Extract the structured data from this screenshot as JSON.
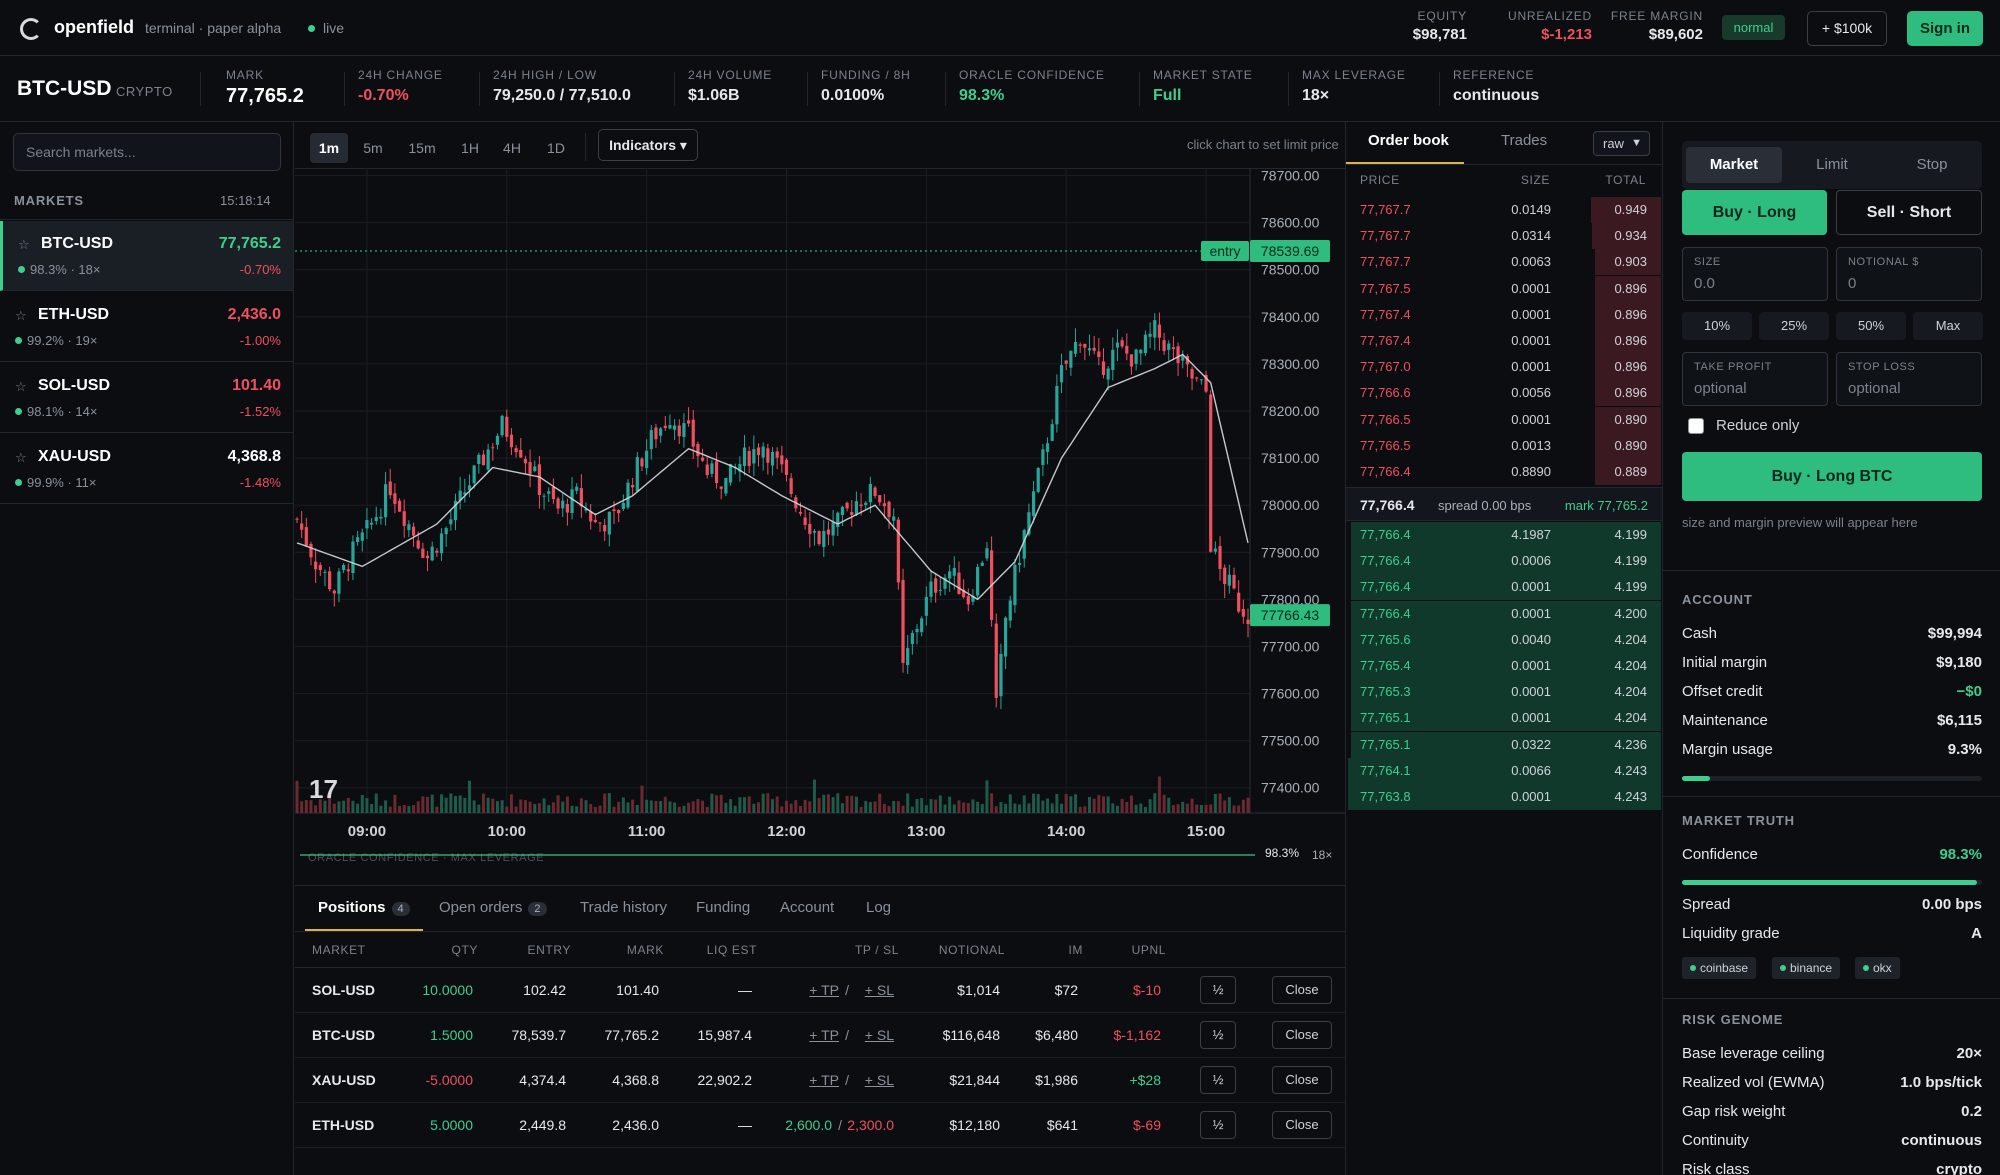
{
  "app": {
    "brand": "openfield",
    "tagline": "terminal · paper alpha",
    "status": "live"
  },
  "account_top": {
    "equity_label": "EQUITY",
    "equity": "$98,781",
    "unrealized_label": "UNREALIZED",
    "unrealized": "$-1,213",
    "free_margin_label": "FREE MARGIN",
    "free_margin": "$89,602",
    "mode": "normal",
    "add_funds": "+ $100k",
    "sign_in": "Sign in"
  },
  "ticker": {
    "symbol": "BTC-USD",
    "class": "CRYPTO",
    "stats": [
      {
        "label": "MARK",
        "value": "77,765.2"
      },
      {
        "label": "24H CHANGE",
        "value": "-0.70%"
      },
      {
        "label": "24H HIGH / LOW",
        "value": "79,250.0 / 77,510.0"
      },
      {
        "label": "24H VOLUME",
        "value": "$1.06B"
      },
      {
        "label": "FUNDING / 8H",
        "value": "0.0100%"
      },
      {
        "label": "ORACLE CONFIDENCE",
        "value": "98.3%"
      },
      {
        "label": "MARKET STATE",
        "value": "Full"
      },
      {
        "label": "MAX LEVERAGE",
        "value": "18×"
      },
      {
        "label": "REFERENCE",
        "value": "continuous"
      }
    ]
  },
  "markets": {
    "search_placeholder": "Search markets...",
    "title": "MARKETS",
    "time": "15:18:14",
    "items": [
      {
        "symbol": "BTC-USD",
        "price": "77,765.2",
        "sub": "98.3% · 18×",
        "change": "-0.70%"
      },
      {
        "symbol": "ETH-USD",
        "price": "2,436.0",
        "sub": "99.2% · 19×",
        "change": "-1.00%"
      },
      {
        "symbol": "SOL-USD",
        "price": "101.40",
        "sub": "98.1% · 14×",
        "change": "-1.52%"
      },
      {
        "symbol": "XAU-USD",
        "price": "4,368.8",
        "sub": "99.9% · 11×",
        "change": "-1.48%"
      }
    ]
  },
  "chart": {
    "timeframes": [
      "1m",
      "5m",
      "15m",
      "1H",
      "4H",
      "1D"
    ],
    "selected_timeframe": "1m",
    "indicators_label": "Indicators ▾",
    "hint": "click chart to set limit price",
    "footer_label": "ORACLE CONFIDENCE · MAX LEVERAGE",
    "footer_conf": "98.3%",
    "footer_lev": "18×"
  },
  "chart_data": {
    "type": "candlestick",
    "x_ticks": [
      "09:00",
      "10:00",
      "11:00",
      "12:00",
      "13:00",
      "14:00",
      "15:00"
    ],
    "y_ticks": [
      "78700.00",
      "78600.00",
      "78500.00",
      "78400.00",
      "78300.00",
      "78200.00",
      "78100.00",
      "78000.00",
      "77900.00",
      "77800.00",
      "77700.00",
      "77600.00",
      "77500.00",
      "77400.00"
    ],
    "ylim": [
      77357,
      78716
    ],
    "entry_label": "entry",
    "entry_price": "78539.69",
    "last_price": "77766.43",
    "close_path": [
      [
        0,
        77970
      ],
      [
        4,
        77880
      ],
      [
        8,
        77820
      ],
      [
        12,
        77900
      ],
      [
        16,
        77960
      ],
      [
        20,
        78040
      ],
      [
        24,
        77960
      ],
      [
        28,
        77890
      ],
      [
        32,
        77950
      ],
      [
        36,
        78030
      ],
      [
        40,
        78100
      ],
      [
        44,
        78170
      ],
      [
        48,
        78120
      ],
      [
        52,
        78040
      ],
      [
        56,
        77990
      ],
      [
        60,
        78020
      ],
      [
        64,
        77960
      ],
      [
        68,
        77970
      ],
      [
        72,
        78060
      ],
      [
        76,
        78140
      ],
      [
        80,
        78190
      ],
      [
        84,
        78150
      ],
      [
        88,
        78070
      ],
      [
        92,
        78050
      ],
      [
        96,
        78100
      ],
      [
        100,
        78130
      ],
      [
        104,
        78070
      ],
      [
        108,
        77990
      ],
      [
        112,
        77930
      ],
      [
        116,
        77960
      ],
      [
        120,
        78010
      ],
      [
        124,
        78030
      ],
      [
        128,
        77980
      ],
      [
        130,
        77650
      ],
      [
        132,
        77720
      ],
      [
        136,
        77820
      ],
      [
        140,
        77860
      ],
      [
        144,
        77800
      ],
      [
        148,
        77920
      ],
      [
        150,
        77570
      ],
      [
        152,
        77760
      ],
      [
        156,
        77940
      ],
      [
        160,
        78100
      ],
      [
        164,
        78280
      ],
      [
        168,
        78360
      ],
      [
        172,
        78290
      ],
      [
        176,
        78330
      ],
      [
        180,
        78310
      ],
      [
        184,
        78370
      ],
      [
        188,
        78320
      ],
      [
        192,
        78270
      ],
      [
        195,
        78240
      ],
      [
        196,
        77920
      ],
      [
        198,
        77860
      ],
      [
        200,
        77830
      ],
      [
        202,
        77790
      ],
      [
        204,
        77766
      ]
    ],
    "ma_path": [
      [
        0,
        77920
      ],
      [
        14,
        77870
      ],
      [
        30,
        77960
      ],
      [
        42,
        78080
      ],
      [
        52,
        78060
      ],
      [
        64,
        77980
      ],
      [
        72,
        78020
      ],
      [
        84,
        78120
      ],
      [
        94,
        78080
      ],
      [
        104,
        78020
      ],
      [
        116,
        77960
      ],
      [
        124,
        78000
      ],
      [
        136,
        77860
      ],
      [
        146,
        77800
      ],
      [
        154,
        77880
      ],
      [
        164,
        78100
      ],
      [
        174,
        78250
      ],
      [
        184,
        78290
      ],
      [
        190,
        78320
      ],
      [
        196,
        78260
      ],
      [
        204,
        77920
      ]
    ],
    "volume_profile": [
      1,
      2,
      1,
      3,
      2,
      1,
      4,
      2,
      1,
      2,
      3,
      1,
      2,
      5,
      2,
      1,
      3,
      2,
      1,
      2,
      6,
      3,
      2,
      1,
      8,
      3,
      2,
      1,
      3,
      2,
      4,
      2
    ]
  },
  "positions": {
    "tabs": [
      {
        "label": "Positions",
        "count": "4"
      },
      {
        "label": "Open orders",
        "count": "2"
      },
      {
        "label": "Trade history",
        "count": ""
      },
      {
        "label": "Funding",
        "count": ""
      },
      {
        "label": "Account",
        "count": ""
      },
      {
        "label": "Log",
        "count": ""
      }
    ],
    "columns": [
      "MARKET",
      "QTY",
      "ENTRY",
      "MARK",
      "LIQ EST",
      "TP / SL",
      "NOTIONAL",
      "IM",
      "UPNL"
    ],
    "rows": [
      {
        "market": "SOL-USD",
        "qty": "10.0000",
        "entry": "102.42",
        "mark": "101.40",
        "liq": "—",
        "tp": "+ TP",
        "sl": "+ SL",
        "notional": "$1,014",
        "im": "$72",
        "upnl": "$-10",
        "half": "½",
        "close": "Close"
      },
      {
        "market": "BTC-USD",
        "qty": "1.5000",
        "entry": "78,539.7",
        "mark": "77,765.2",
        "liq": "15,987.4",
        "tp": "+ TP",
        "sl": "+ SL",
        "notional": "$116,648",
        "im": "$6,480",
        "upnl": "$-1,162",
        "half": "½",
        "close": "Close"
      },
      {
        "market": "XAU-USD",
        "qty": "-5.0000",
        "entry": "4,374.4",
        "mark": "4,368.8",
        "liq": "22,902.2",
        "tp": "+ TP",
        "sl": "+ SL",
        "notional": "$21,844",
        "im": "$1,986",
        "upnl": "+$28",
        "half": "½",
        "close": "Close"
      },
      {
        "market": "ETH-USD",
        "qty": "5.0000",
        "entry": "2,449.8",
        "mark": "2,436.0",
        "liq": "—",
        "tp": "2,600.0",
        "sl": "2,300.0",
        "notional": "$12,180",
        "im": "$641",
        "upnl": "$-69",
        "half": "½",
        "close": "Close"
      }
    ]
  },
  "orderbook": {
    "tabs": [
      "Order book",
      "Trades"
    ],
    "mode": "raw",
    "columns": [
      "PRICE",
      "SIZE",
      "TOTAL"
    ],
    "asks": [
      {
        "price": "77,767.7",
        "size": "0.0149",
        "total": "0.949",
        "depth": 1.0
      },
      {
        "price": "77,767.7",
        "size": "0.0314",
        "total": "0.934",
        "depth": 0.98
      },
      {
        "price": "77,767.7",
        "size": "0.0063",
        "total": "0.903",
        "depth": 0.95
      },
      {
        "price": "77,767.5",
        "size": "0.0001",
        "total": "0.896",
        "depth": 0.94
      },
      {
        "price": "77,767.4",
        "size": "0.0001",
        "total": "0.896",
        "depth": 0.94
      },
      {
        "price": "77,767.4",
        "size": "0.0001",
        "total": "0.896",
        "depth": 0.94
      },
      {
        "price": "77,767.0",
        "size": "0.0001",
        "total": "0.896",
        "depth": 0.94
      },
      {
        "price": "77,766.6",
        "size": "0.0056",
        "total": "0.896",
        "depth": 0.94
      },
      {
        "price": "77,766.5",
        "size": "0.0001",
        "total": "0.890",
        "depth": 0.94
      },
      {
        "price": "77,766.5",
        "size": "0.0013",
        "total": "0.890",
        "depth": 0.94
      },
      {
        "price": "77,766.4",
        "size": "0.8890",
        "total": "0.889",
        "depth": 0.94
      }
    ],
    "mid": {
      "price": "77,766.4",
      "spread": "spread 0.00 bps",
      "mark": "mark 77,765.2"
    },
    "bids": [
      {
        "price": "77,766.4",
        "size": "4.1987",
        "total": "4.199",
        "depth": 0.99
      },
      {
        "price": "77,766.4",
        "size": "0.0006",
        "total": "4.199",
        "depth": 0.99
      },
      {
        "price": "77,766.4",
        "size": "0.0001",
        "total": "4.199",
        "depth": 0.99
      },
      {
        "price": "77,766.4",
        "size": "0.0001",
        "total": "4.200",
        "depth": 0.99
      },
      {
        "price": "77,765.6",
        "size": "0.0040",
        "total": "4.204",
        "depth": 0.99
      },
      {
        "price": "77,765.4",
        "size": "0.0001",
        "total": "4.204",
        "depth": 0.99
      },
      {
        "price": "77,765.3",
        "size": "0.0001",
        "total": "4.204",
        "depth": 0.99
      },
      {
        "price": "77,765.1",
        "size": "0.0001",
        "total": "4.204",
        "depth": 0.99
      },
      {
        "price": "77,765.1",
        "size": "0.0322",
        "total": "4.236",
        "depth": 0.99
      },
      {
        "price": "77,764.1",
        "size": "0.0066",
        "total": "4.243",
        "depth": 1.0
      },
      {
        "price": "77,763.8",
        "size": "0.0001",
        "total": "4.243",
        "depth": 1.0
      }
    ]
  },
  "ticket": {
    "types": [
      "Market",
      "Limit",
      "Stop"
    ],
    "buy_label": "Buy · Long",
    "sell_label": "Sell · Short",
    "size_label": "SIZE",
    "size_placeholder": "0.0",
    "notional_label": "NOTIONAL $",
    "notional_placeholder": "0",
    "pcts": [
      "10%",
      "25%",
      "50%",
      "Max"
    ],
    "tp_label": "TAKE PROFIT",
    "tp_placeholder": "optional",
    "sl_label": "STOP LOSS",
    "sl_placeholder": "optional",
    "reduce_only": "Reduce only",
    "submit": "Buy · Long BTC",
    "hint": "size and margin preview will appear here"
  },
  "account": {
    "title": "ACCOUNT",
    "rows": [
      {
        "k": "Cash",
        "v": "$99,994"
      },
      {
        "k": "Initial margin",
        "v": "$9,180"
      },
      {
        "k": "Offset credit",
        "v": "−$0"
      },
      {
        "k": "Maintenance",
        "v": "$6,115"
      },
      {
        "k": "Margin usage",
        "v": "9.3%"
      }
    ],
    "margin_usage_fraction": 0.093
  },
  "market_truth": {
    "title": "MARKET TRUTH",
    "confidence_label": "Confidence",
    "confidence": "98.3%",
    "confidence_fraction": 0.983,
    "spread_label": "Spread",
    "spread": "0.00 bps",
    "liquidity_label": "Liquidity grade",
    "liquidity": "A",
    "sources": [
      "coinbase",
      "binance",
      "okx"
    ]
  },
  "risk_genome": {
    "title": "RISK GENOME",
    "rows": [
      {
        "k": "Base leverage ceiling",
        "v": "20×"
      },
      {
        "k": "Realized vol (EWMA)",
        "v": "1.0 bps/tick"
      },
      {
        "k": "Gap risk weight",
        "v": "0.2"
      },
      {
        "k": "Continuity",
        "v": "continuous"
      },
      {
        "k": "Risk class",
        "v": "crypto"
      }
    ]
  },
  "colors": {
    "accent": "#2ebd7f",
    "up": "#3ecf8e",
    "down": "#f0505f",
    "bg": "#0b0d11",
    "panel_line": "#22262d"
  }
}
